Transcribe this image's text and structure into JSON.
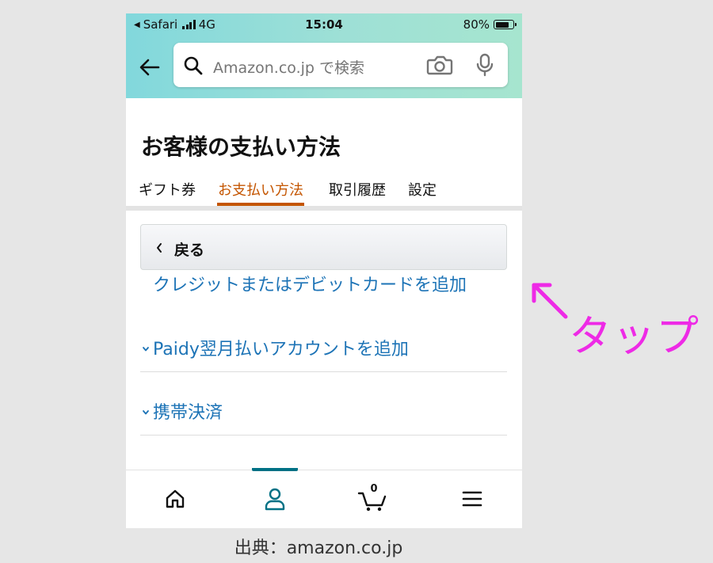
{
  "status_bar": {
    "carrier": "Safari",
    "network": "4G",
    "time": "15:04",
    "battery": "80%",
    "battery_level": 0.8
  },
  "header": {
    "search_placeholder": "Amazon.co.jp で検索"
  },
  "page": {
    "title": "お客様の支払い方法",
    "tabs": [
      {
        "label": "ギフト券",
        "active": false
      },
      {
        "label": "お支払い方法",
        "active": true
      },
      {
        "label": "取引履歴",
        "active": false
      },
      {
        "label": "設定",
        "active": false
      }
    ],
    "back_label": "戻る",
    "add_card_link": "クレジットまたはデビットカードを追加",
    "sections": [
      {
        "label": "Paidy翌月払いアカウントを追加"
      },
      {
        "label": "携帯決済"
      }
    ]
  },
  "bottom_nav": {
    "items": [
      "home-icon",
      "account-icon",
      "cart-icon",
      "menu-icon"
    ],
    "active": "account-icon",
    "cart_count": "0"
  },
  "annotation": {
    "text": "タップ",
    "color": "#ee2ae6"
  },
  "credit": "出典：amazon.co.jp",
  "colors": {
    "link": "#1c73b6",
    "tab_active": "#c45500",
    "nav_active": "#007185"
  }
}
